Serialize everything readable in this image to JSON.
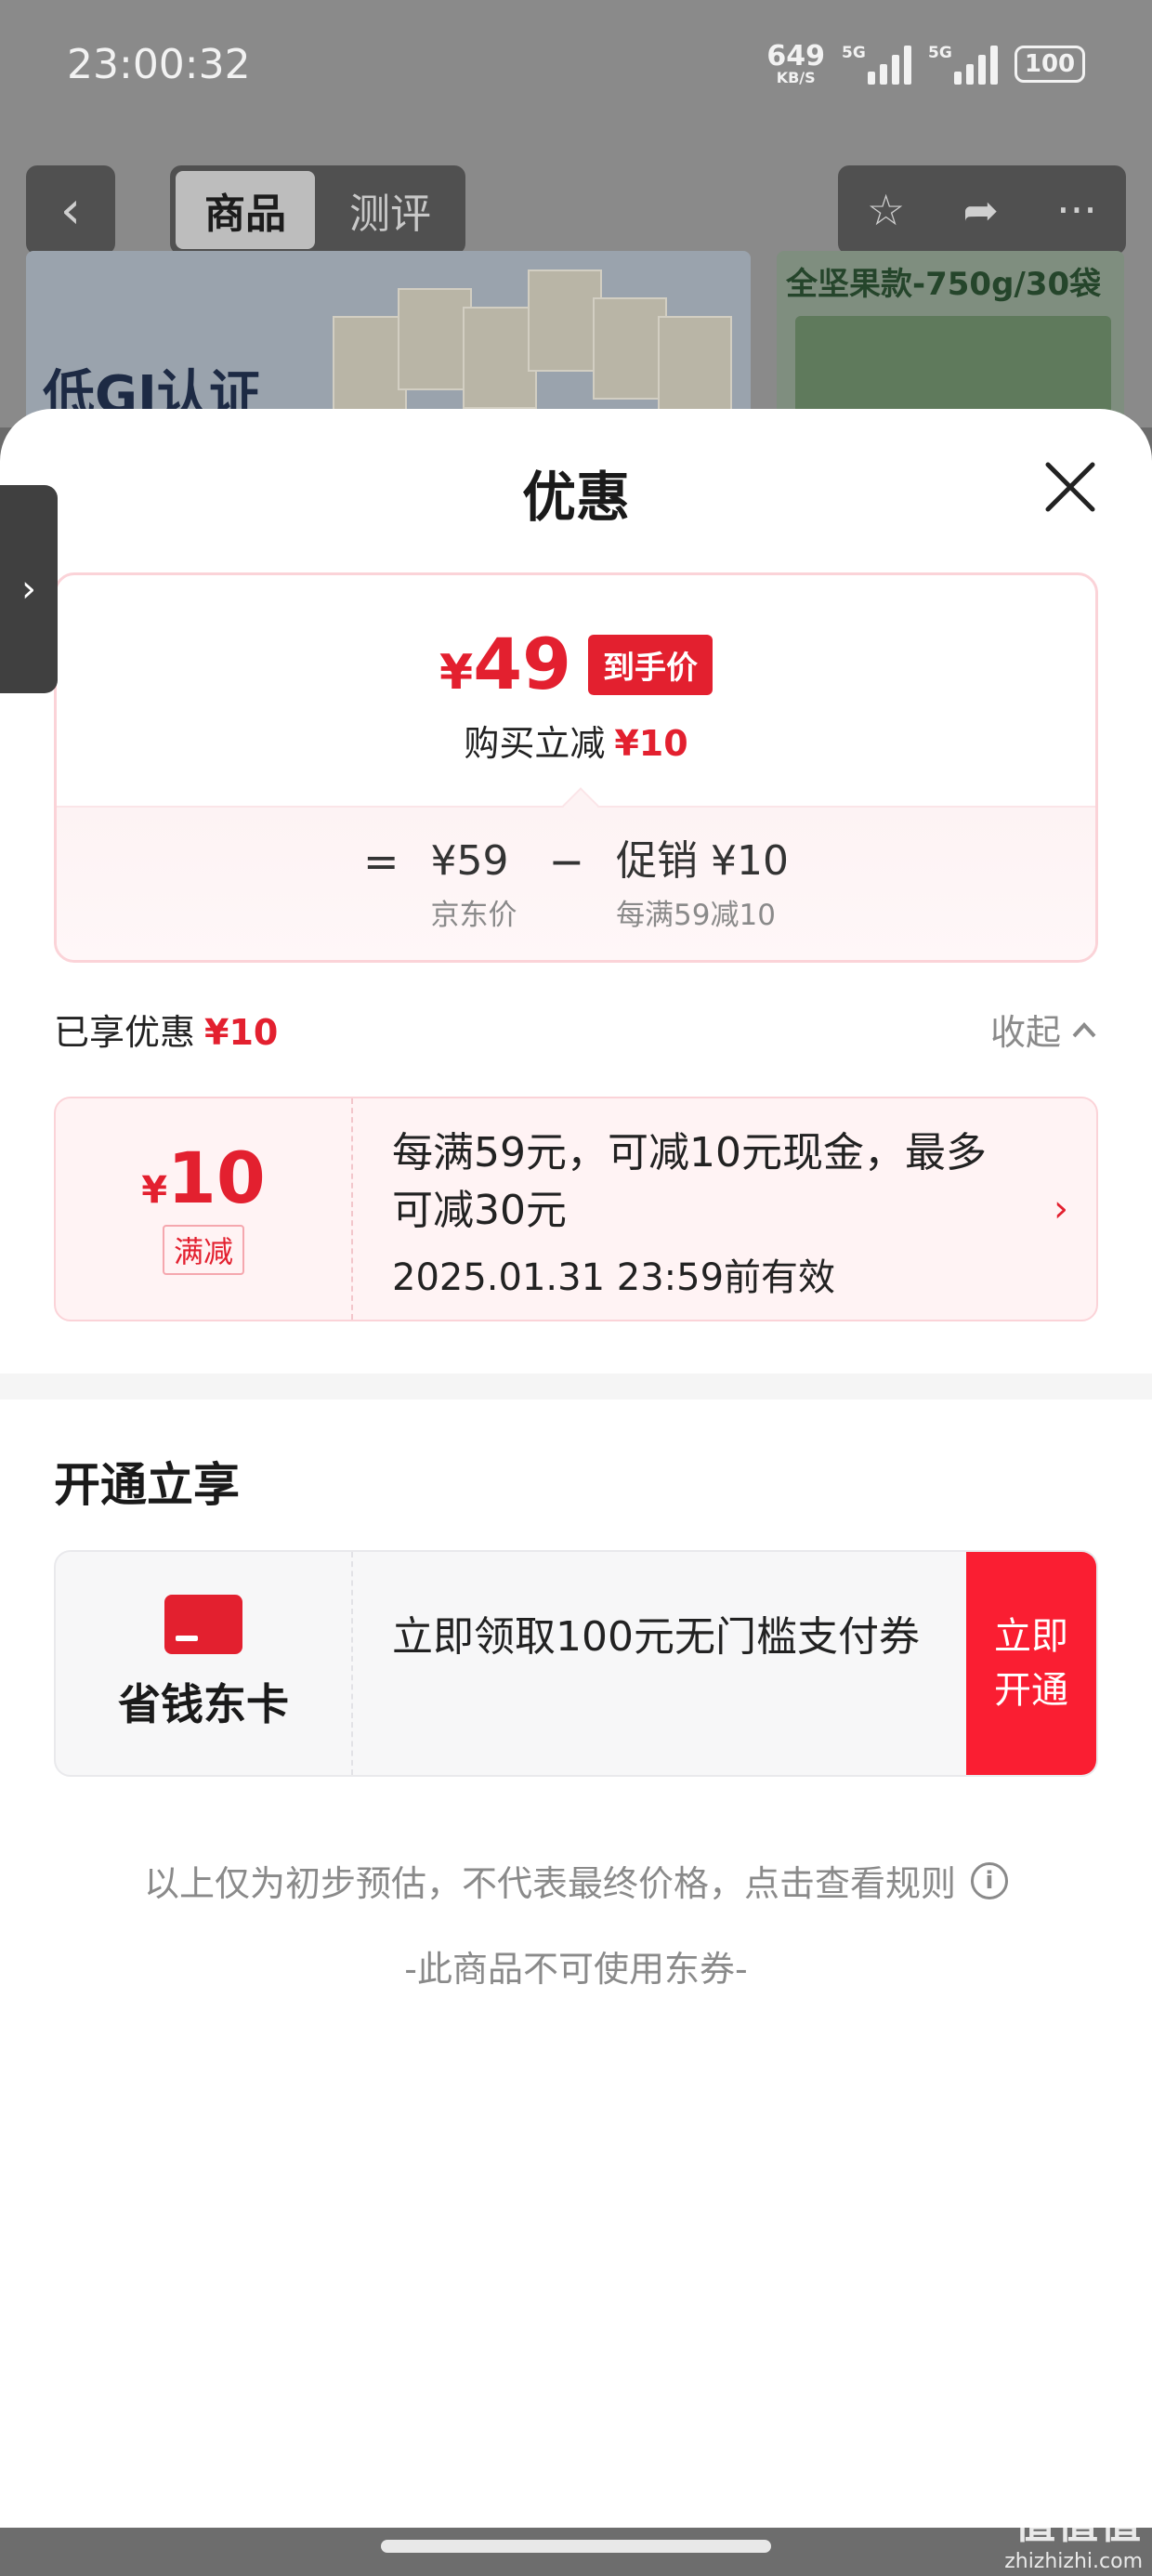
{
  "status_bar": {
    "time": "23:00:32",
    "net_speed": "649",
    "net_unit": "KB/S",
    "signal1": "5G",
    "signal2": "5G",
    "battery": "100"
  },
  "nav": {
    "tab_goods": "商品",
    "tab_review": "测评",
    "back_icon": "chevron-left-icon",
    "star_icon": "star-icon",
    "share_icon": "share-icon",
    "more_icon": "more-icon"
  },
  "banner": {
    "left_text": "低GI认证",
    "right_text": "全坚果款-750g/30袋"
  },
  "sheet": {
    "title": "优惠",
    "final_price": "49",
    "currency": "¥",
    "final_tag": "到手价",
    "instant_save_label": "购买立减",
    "instant_save_amount": "¥10",
    "formula": {
      "eq": "=",
      "minus": "−",
      "jd_price": "¥59",
      "jd_price_label": "京东价",
      "promo": "促销 ¥10",
      "promo_label": "每满59减10"
    },
    "enjoyed_label": "已享优惠",
    "enjoyed_amount": "¥10",
    "collapse_label": "收起",
    "coupon": {
      "amount": "10",
      "type": "满减",
      "desc": "每满59元，可减10元现金，最多可减30元",
      "valid": "2025.01.31 23:59前有效"
    },
    "open_title": "开通立享",
    "card": {
      "name": "省钱东卡",
      "desc": "立即领取100元无门槛支付券",
      "button_line1": "立即",
      "button_line2": "开通"
    },
    "note": "以上仅为初步预估，不代表最终价格，点击查看规则",
    "note2": "-此商品不可使用东券-"
  },
  "watermark": {
    "main": "值值值",
    "sub": "zhizhizhi.com"
  },
  "colors": {
    "accent": "#e3202f",
    "button_red": "#fa1e32"
  }
}
